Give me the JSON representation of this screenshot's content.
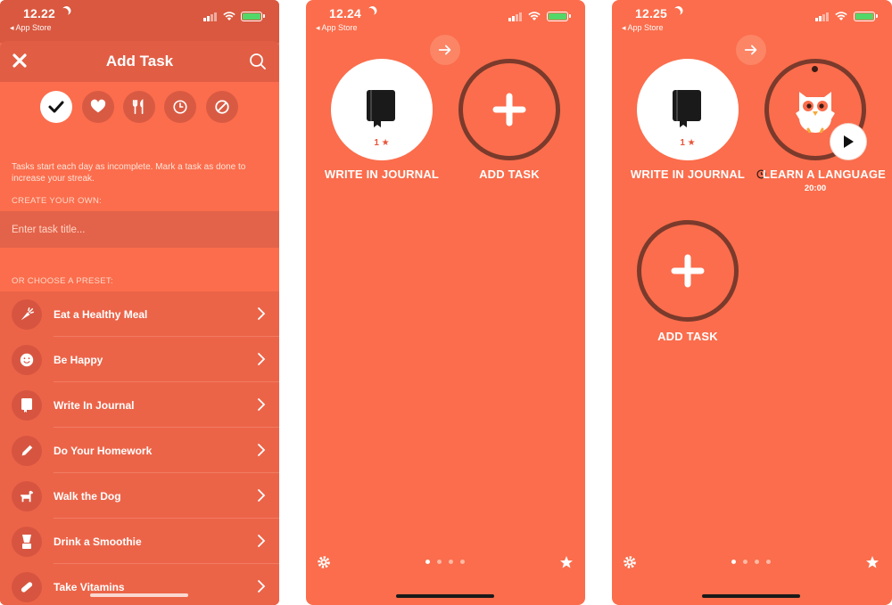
{
  "colors": {
    "accent": "#fb6d4c",
    "ring": "#7a3a2c",
    "white": "#ffffff"
  },
  "screen1": {
    "status": {
      "time": "12.22",
      "back": "◂ App Store"
    },
    "nav": {
      "title": "Add Task",
      "close_icon": "close-icon",
      "search_icon": "search-icon"
    },
    "filters": [
      "check-icon",
      "heart-icon",
      "utensils-icon",
      "clock-icon",
      "block-icon"
    ],
    "hint": "Tasks start each day as incomplete. Mark a task as done to increase your streak.",
    "create_label": "CREATE YOUR OWN:",
    "input_placeholder": "Enter task title...",
    "preset_label": "OR CHOOSE A PRESET:",
    "presets": [
      {
        "label": "Eat a Healthy Meal",
        "icon": "carrot-icon"
      },
      {
        "label": "Be Happy",
        "icon": "smiley-icon"
      },
      {
        "label": "Write In Journal",
        "icon": "journal-icon"
      },
      {
        "label": "Do Your Homework",
        "icon": "pencil-icon"
      },
      {
        "label": "Walk the Dog",
        "icon": "dog-icon"
      },
      {
        "label": "Drink a Smoothie",
        "icon": "blender-icon"
      },
      {
        "label": "Take Vitamins",
        "icon": "pill-icon"
      }
    ]
  },
  "screen2": {
    "status": {
      "time": "12.24",
      "back": "◂ App Store"
    },
    "journal": {
      "label": "WRITE IN JOURNAL",
      "stars": "1 ★"
    },
    "add": {
      "label": "ADD TASK"
    }
  },
  "screen3": {
    "status": {
      "time": "12.25",
      "back": "◂ App Store"
    },
    "journal": {
      "label": "WRITE IN JOURNAL",
      "stars": "1 ★"
    },
    "language": {
      "label": "LEARN A LANGUAGE",
      "timer": "20:00"
    },
    "add": {
      "label": "ADD TASK"
    }
  }
}
